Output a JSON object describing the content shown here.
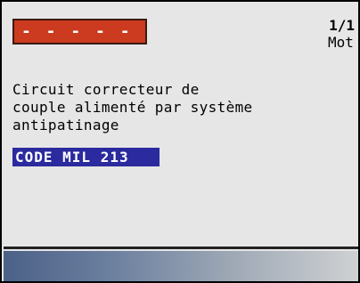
{
  "header": {
    "code_placeholder": "- - - - -",
    "page_counter": "1/1",
    "module_label": "Mot"
  },
  "body": {
    "description": "Circuit correcteur de\ncouple alimenté par système\nantipatinage",
    "mil_code": "CODE MIL 213"
  },
  "colors": {
    "code_box": "#cc3a1f",
    "selection": "#2b2a9e",
    "background": "#e6e6e6"
  }
}
